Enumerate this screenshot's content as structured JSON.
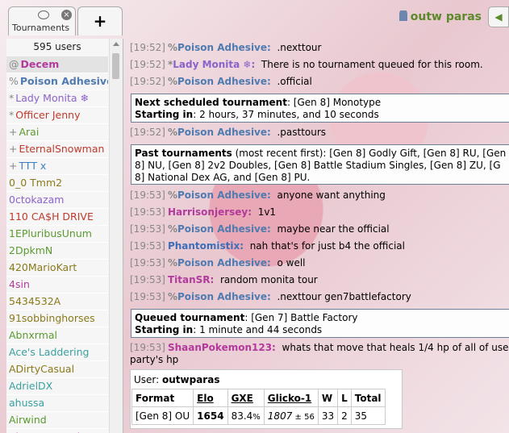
{
  "tabs": {
    "tournaments_label": "Tournaments",
    "close_symbol": "×",
    "add_symbol": "+"
  },
  "header": {
    "username": "outw paras",
    "sound_symbol": "◀"
  },
  "userlist": {
    "count_label": "595 users",
    "users": [
      {
        "rank": "@",
        "name": "Decem",
        "color": "#b23a9c",
        "bold": true
      },
      {
        "rank": "%",
        "name": "Poison Adhesive",
        "color": "#4f7bb0",
        "bold": true
      },
      {
        "rank": "*",
        "name": "Lady Monita ❄",
        "color": "#8b62c9",
        "bold": false
      },
      {
        "rank": "*",
        "name": "Officer Jenny",
        "color": "#c0392b",
        "bold": false
      },
      {
        "rank": "+",
        "name": "Arai",
        "color": "#5b9a2f",
        "bold": false
      },
      {
        "rank": "+",
        "name": "EternalSnowman",
        "color": "#c0392b",
        "bold": false
      },
      {
        "rank": "+",
        "name": "TTT x",
        "color": "#3d7ec4",
        "bold": false
      },
      {
        "rank": "",
        "name": "0_0 Tmm2",
        "color": "#8a7a1a",
        "bold": false
      },
      {
        "rank": "",
        "name": "0ctokazam",
        "color": "#8b62c9",
        "bold": false
      },
      {
        "rank": "",
        "name": "110 CA$H DRIVE",
        "color": "#c0392b",
        "bold": false
      },
      {
        "rank": "",
        "name": "1EPluribusUnum",
        "color": "#5b9a2f",
        "bold": false
      },
      {
        "rank": "",
        "name": "2DpkmN",
        "color": "#5b9a2f",
        "bold": false
      },
      {
        "rank": "",
        "name": "420MarioKart",
        "color": "#8a7a1a",
        "bold": false
      },
      {
        "rank": "",
        "name": "4sin",
        "color": "#b23a9c",
        "bold": false
      },
      {
        "rank": "",
        "name": "5434532A",
        "color": "#8a7a1a",
        "bold": false
      },
      {
        "rank": "",
        "name": "91sobbinghorses",
        "color": "#8a7a1a",
        "bold": false
      },
      {
        "rank": "",
        "name": "Abnxrmal",
        "color": "#5b9a2f",
        "bold": false
      },
      {
        "rank": "",
        "name": "Ace's Laddering",
        "color": "#3aa0a0",
        "bold": false
      },
      {
        "rank": "",
        "name": "ADirtyCasual",
        "color": "#8a7a1a",
        "bold": false
      },
      {
        "rank": "",
        "name": "AdrielDX",
        "color": "#3aa0a0",
        "bold": false
      },
      {
        "rank": "",
        "name": "ahussa",
        "color": "#3aa0a0",
        "bold": false
      },
      {
        "rank": "",
        "name": "Airwind",
        "color": "#5b9a2f",
        "bold": false
      },
      {
        "rank": "",
        "name": "Akame-Temari",
        "color": "#b23a9c",
        "bold": false
      }
    ]
  },
  "chat": {
    "messages": [
      {
        "time": "[19:52]",
        "rank": "%",
        "nick": "Poison Adhesive:",
        "color": "#4f7bb0",
        "text": ".nexttour"
      },
      {
        "time": "[19:52]",
        "rank": "*",
        "nick": "Lady Monita ❄:",
        "color": "#8b62c9",
        "text": "There is no tournament queued for this room."
      },
      {
        "time": "[19:52]",
        "rank": "%",
        "nick": "Poison Adhesive:",
        "color": "#4f7bb0",
        "text": ".official"
      },
      {
        "time": "[19:52]",
        "rank": "%",
        "nick": "Poison Adhesive:",
        "color": "#4f7bb0",
        "text": ".pasttours"
      },
      {
        "time": "[19:53]",
        "rank": "%",
        "nick": "Poison Adhesive:",
        "color": "#4f7bb0",
        "text": "anyone want anything"
      },
      {
        "time": "[19:53]",
        "rank": "",
        "nick": "Harrisonjersey:",
        "color": "#b23a9c",
        "text": "1v1"
      },
      {
        "time": "[19:53]",
        "rank": "%",
        "nick": "Poison Adhesive:",
        "color": "#4f7bb0",
        "text": "maybe near the official"
      },
      {
        "time": "[19:53]",
        "rank": "",
        "nick": "Phantomistix:",
        "color": "#3d6fb8",
        "text": "nah that's for just b4 the official"
      },
      {
        "time": "[19:53]",
        "rank": "%",
        "nick": "Poison Adhesive:",
        "color": "#4f7bb0",
        "text": "o well"
      },
      {
        "time": "[19:53]",
        "rank": "",
        "nick": "TitanSR:",
        "color": "#b23a9c",
        "text": "random monita tour"
      },
      {
        "time": "[19:53]",
        "rank": "%",
        "nick": "Poison Adhesive:",
        "color": "#4f7bb0",
        "text": ".nexttour gen7battlefactory"
      },
      {
        "time": "[19:53]",
        "rank": "",
        "nick": "ShaanPokemon123:",
        "color": "#b23a9c",
        "text": "whats that move that heals 1/4 hp of all of use"
      },
      {
        "time": "",
        "rank": "",
        "nick": "",
        "color": "#000",
        "text": "party's hp"
      }
    ],
    "next_box": {
      "line1_label": "Next scheduled tournament",
      "line1_value": ": [Gen 8] Monotype",
      "line2_label": "Starting in",
      "line2_value": ": 2 hours, 37 minutes, and 10 seconds"
    },
    "past_box": {
      "label": "Past tournaments",
      "line1": " (most recent first): [Gen 8] Godly Gift, [Gen 8] RU, [Gen",
      "line2": "8] NU, [Gen 8] 2v2 Doubles, [Gen 8] Battle Stadium Singles, [Gen 8] ZU, [G",
      "line3": "8] National Dex AG, and [Gen 8] PU."
    },
    "queued_box": {
      "line1_label": "Queued tournament",
      "line1_value": ": [Gen 7] Battle Factory",
      "line2_label": "Starting in",
      "line2_value": ": 1 minute and 44 seconds"
    },
    "user_table": {
      "user_label": "User: ",
      "user_name": "outwparas",
      "headers": [
        "Format",
        "Elo",
        "GXE",
        "Glicko-1",
        "W",
        "L",
        "Total"
      ],
      "row": {
        "format": "[Gen 8] OU",
        "elo": "1654",
        "gxe": "83.4",
        "gxe_unit": "%",
        "glicko": "1807",
        "glicko_dev": " ± 56",
        "w": "33",
        "l": "2",
        "total": "35"
      }
    }
  }
}
